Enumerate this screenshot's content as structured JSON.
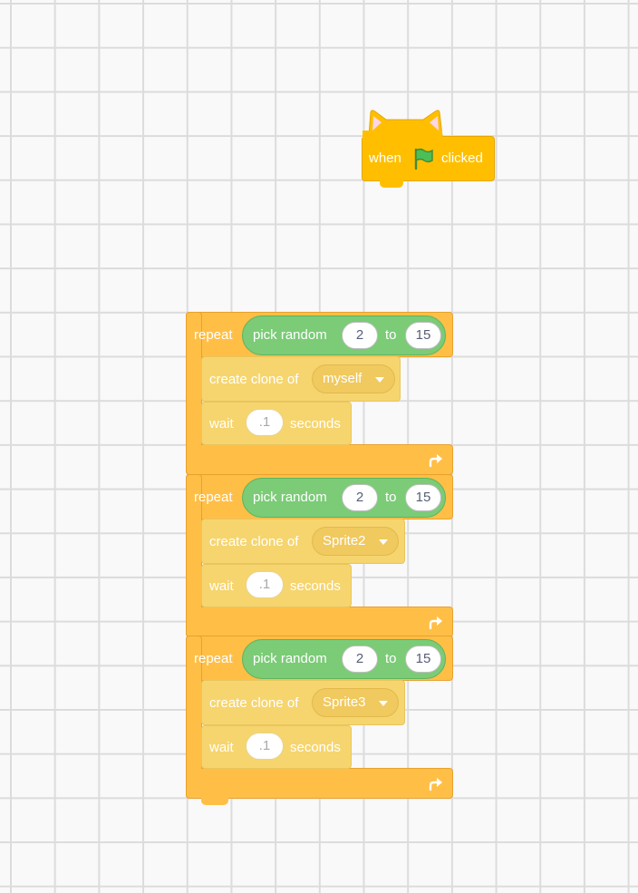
{
  "hat": {
    "when_label": "when",
    "flag_icon": "green-flag-icon",
    "clicked_label": "clicked",
    "color": "#ffbf00"
  },
  "repeats": [
    {
      "repeat_label": "repeat",
      "pick_random_label": "pick random",
      "from": "2",
      "to_label": "to",
      "to": "15",
      "clone_label": "create clone of",
      "clone_target": "myself",
      "wait_label": "wait",
      "wait_value": ".1",
      "seconds_label": "seconds",
      "loop_icon": "loop-arrow-icon"
    },
    {
      "repeat_label": "repeat",
      "pick_random_label": "pick random",
      "from": "2",
      "to_label": "to",
      "to": "15",
      "clone_label": "create clone of",
      "clone_target": "Sprite2",
      "wait_label": "wait",
      "wait_value": ".1",
      "seconds_label": "seconds",
      "loop_icon": "loop-arrow-icon"
    },
    {
      "repeat_label": "repeat",
      "pick_random_label": "pick random",
      "from": "2",
      "to_label": "to",
      "to": "15",
      "clone_label": "create clone of",
      "clone_target": "Sprite3",
      "wait_label": "wait",
      "wait_value": ".1",
      "seconds_label": "seconds",
      "loop_icon": "loop-arrow-icon"
    }
  ],
  "colors": {
    "control": "#ffbf47",
    "control_inner": "#f6d56f",
    "operator": "#7bcb77",
    "grid_line": "#dcdcdc",
    "background": "#f9f9f9"
  }
}
